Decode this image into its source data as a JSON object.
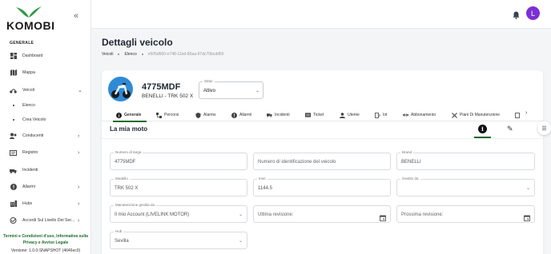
{
  "brand": {
    "logo_text": "KOMOBI"
  },
  "sidebar": {
    "section_label": "GENERALE",
    "items": [
      {
        "label": "Dashboard",
        "icon": "dashboard-icon"
      },
      {
        "label": "Mappa",
        "icon": "map-icon"
      },
      {
        "label": "Veicoli",
        "icon": "motorbike-icon"
      },
      {
        "label": "Conducenti",
        "icon": "drivers-icon"
      },
      {
        "label": "Registro",
        "icon": "register-icon"
      },
      {
        "label": "Incidenti",
        "icon": "incident-icon"
      },
      {
        "label": "Allarmi",
        "icon": "alarm-icon"
      },
      {
        "label": "Hubs",
        "icon": "hub-icon"
      },
      {
        "label": "Accordi Sul Livello Dei Ser...",
        "icon": "agreement-icon"
      }
    ],
    "sub_items": [
      {
        "label": "Elenco"
      },
      {
        "label": "Crea Veicolo"
      }
    ],
    "footer": {
      "terms_line1": "Termini e Condizioni d'uso, Informativa sulla",
      "terms_line2": "Privacy e Avviso Legale",
      "version": "Versione: 1.0.0-SNAPSHOT (4646ec0)"
    }
  },
  "topbar": {
    "avatar_initial": "L"
  },
  "page": {
    "title": "Dettagli veicolo",
    "breadcrumb": [
      "Veicoli",
      "Elenco",
      "e505d660-e748-11ed-80aa-97dc70bcdd50"
    ]
  },
  "vehicle": {
    "plate": "4775MDF",
    "model_line": "BENELLI - TRK 502 X",
    "status_label": "Stato",
    "status_value": "Attivo"
  },
  "tabs": [
    {
      "label": "Generale",
      "icon": "info-icon"
    },
    {
      "label": "Percorsi",
      "icon": "route-icon"
    },
    {
      "label": "Alarms",
      "icon": "shield-icon"
    },
    {
      "label": "Allarmi",
      "icon": "warning-icon"
    },
    {
      "label": "Incidenti",
      "icon": "car-crash-icon"
    },
    {
      "label": "Ticket",
      "icon": "ticket-icon"
    },
    {
      "label": "Utente",
      "icon": "user-icon"
    },
    {
      "label": "Iot",
      "icon": "iot-icon"
    },
    {
      "label": "Abbonamento",
      "icon": "subscription-icon"
    },
    {
      "label": "Piani Di Manutenzione",
      "icon": "wrench-icon"
    }
  ],
  "section": {
    "title": "La mia moto"
  },
  "form": {
    "plate_number": {
      "label": "Numero di targa",
      "value": "4775MDF"
    },
    "vin": {
      "placeholder": "Numero di identificazione del veicolo"
    },
    "brand": {
      "label": "Brand",
      "value": "BENELLI"
    },
    "model": {
      "label": "Modello",
      "value": "TRK 502 X"
    },
    "imei": {
      "label": "Imei",
      "value": "1144.5"
    },
    "managed_by": {
      "label": "Gestito da"
    },
    "maintenance_by": {
      "label": "Manutenzione gestita da",
      "value": "Il mio Account (LIVELINK MOTOR)"
    },
    "last_revision": {
      "placeholder": "Ultima revisione:"
    },
    "next_revision": {
      "placeholder": "Prossima revisione:"
    },
    "hub": {
      "label": "Hub",
      "value": "Sevilla"
    }
  },
  "colors": {
    "accent": "#1f6b2c",
    "avatar": "#7b2fd4",
    "vehicle_bg": "#2f8ad6"
  }
}
